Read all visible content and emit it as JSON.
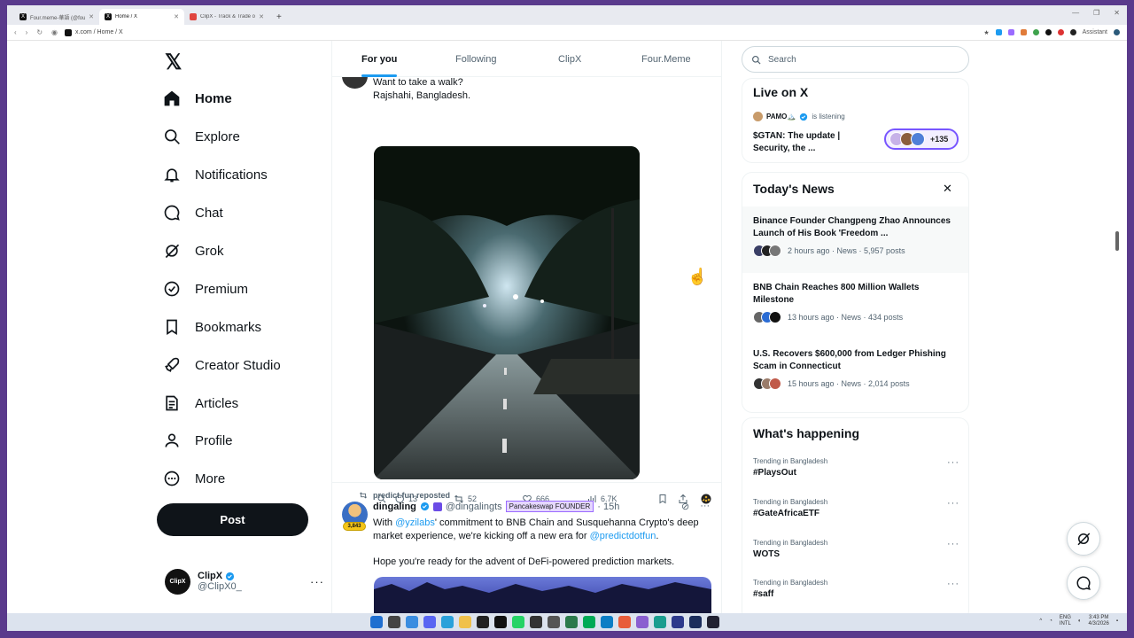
{
  "browser": {
    "tabs": [
      {
        "title": "Four.meme-華語 (@fourdotm",
        "active": false
      },
      {
        "title": "Home / X",
        "active": true
      },
      {
        "title": "ClipX - Track & Trade on X - C",
        "active": false
      }
    ],
    "address": "x.com / Home / X",
    "assistant_label": "Assistant"
  },
  "nav": {
    "logo": "𝕏",
    "items": [
      {
        "label": "Home",
        "icon": "home-icon"
      },
      {
        "label": "Explore",
        "icon": "search-icon"
      },
      {
        "label": "Notifications",
        "icon": "bell-icon"
      },
      {
        "label": "Chat",
        "icon": "chat-icon"
      },
      {
        "label": "Grok",
        "icon": "grok-icon"
      },
      {
        "label": "Premium",
        "icon": "premium-icon"
      },
      {
        "label": "Bookmarks",
        "icon": "bookmark-icon"
      },
      {
        "label": "Creator Studio",
        "icon": "rocket-icon"
      },
      {
        "label": "Articles",
        "icon": "article-icon"
      },
      {
        "label": "Profile",
        "icon": "profile-icon"
      },
      {
        "label": "More",
        "icon": "more-circle-icon"
      }
    ],
    "post_button": "Post",
    "account": {
      "avatar_text": "ClipX",
      "name": "ClipX",
      "handle": "@ClipX0_"
    }
  },
  "feed": {
    "tabs": [
      "For you",
      "Following",
      "ClipX",
      "Four.Meme"
    ],
    "post1": {
      "line1": "Want to take a walk?",
      "line2": "Rajshahi, Bangladesh.",
      "replies": "13",
      "reposts": "52",
      "likes": "666",
      "views": "6.7K"
    },
    "post2": {
      "repost_by": "predict.fun reposted",
      "name": "dingaling",
      "handle": "@dingalingts",
      "affiliation": "Pancakeswap FOUNDER",
      "time": "· 15h",
      "badge_count": "3,843",
      "body_prefix": "With ",
      "mention1": "@yzilabs",
      "body_mid": "' commitment to BNB Chain and Susquehanna Crypto's deep market experience, we're kicking off a new era for ",
      "mention2": "@predictdotfun",
      "body_end": ".",
      "body_line2": "Hope you're ready for the advent of DeFi-powered prediction markets."
    }
  },
  "sidebar": {
    "search_placeholder": "Search",
    "live": {
      "title": "Live on X",
      "host": "PAMO🏔️",
      "status": "is listening",
      "space_title": "$GTAN: The update | Security, the ...",
      "listeners": "+135"
    },
    "news": {
      "title": "Today's News",
      "close": "✕",
      "items": [
        {
          "headline": "Binance Founder Changpeng Zhao Announces Launch of His Book 'Freedom ...",
          "meta": "2 hours ago · News · 5,957 posts"
        },
        {
          "headline": "BNB Chain Reaches 800 Million Wallets Milestone",
          "meta": "13 hours ago · News · 434 posts"
        },
        {
          "headline": "U.S. Recovers $600,000 from Ledger Phishing Scam in Connecticut",
          "meta": "15 hours ago · News · 2,014 posts"
        }
      ]
    },
    "happening": {
      "title": "What's happening",
      "items": [
        {
          "context": "Trending in Bangladesh",
          "name": "#PlaysOut"
        },
        {
          "context": "Trending in Bangladesh",
          "name": "#GateAfricaETF"
        },
        {
          "context": "Trending in Bangladesh",
          "name": "WOTS"
        },
        {
          "context": "Trending in Bangladesh",
          "name": "#saff"
        }
      ]
    }
  },
  "taskbar": {
    "lang_top": "ENG",
    "lang_bottom": "INTL",
    "time": "3:43 PM",
    "date": "4/3/2026"
  },
  "colors": {
    "accent": "#1d9bf0",
    "ink": "#0f1419",
    "muted": "#536471",
    "desktop": "#5a3a8c"
  }
}
